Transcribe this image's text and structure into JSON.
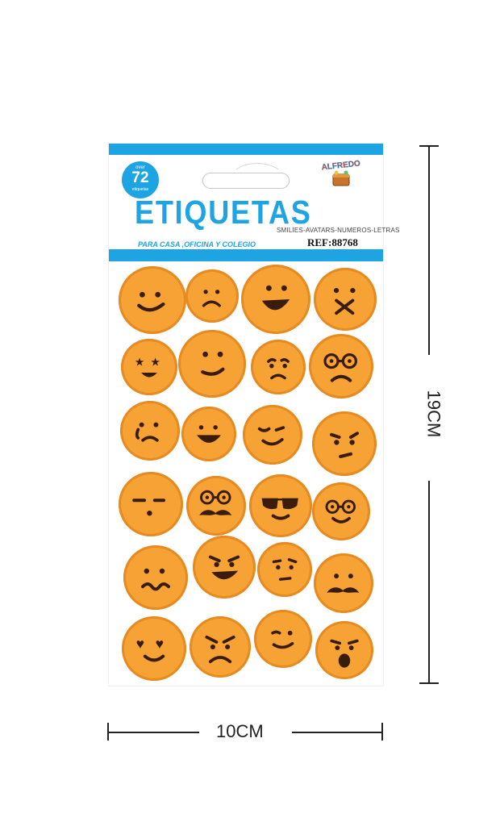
{
  "package": {
    "badge": {
      "over": "over",
      "count": "72",
      "unit": "etiquetas"
    },
    "brand": "ALFREDO",
    "title": "ETIQUETAS",
    "subtitle": "SMILIES-AVATARS-NUMEROS-LETRAS",
    "tagline": "PARA CASA ,OFICINA Y COLEGIO",
    "ref": "REF:88768"
  },
  "colors": {
    "accent": "#1ea4e3",
    "sticker": "#f6a234",
    "sticker_rim": "#e68a22",
    "ink": "#3a1c0c"
  },
  "stickers": [
    {
      "row": 1,
      "col": 1,
      "expression": "smile"
    },
    {
      "row": 1,
      "col": 2,
      "expression": "sad"
    },
    {
      "row": 1,
      "col": 3,
      "expression": "laugh"
    },
    {
      "row": 1,
      "col": 4,
      "expression": "taped-mouth"
    },
    {
      "row": 2,
      "col": 1,
      "expression": "star-eyes"
    },
    {
      "row": 2,
      "col": 2,
      "expression": "smirk"
    },
    {
      "row": 2,
      "col": 3,
      "expression": "worried"
    },
    {
      "row": 2,
      "col": 4,
      "expression": "glasses-frown"
    },
    {
      "row": 3,
      "col": 1,
      "expression": "crying"
    },
    {
      "row": 3,
      "col": 2,
      "expression": "grin"
    },
    {
      "row": 3,
      "col": 3,
      "expression": "wink"
    },
    {
      "row": 3,
      "col": 4,
      "expression": "suspicious"
    },
    {
      "row": 4,
      "col": 1,
      "expression": "surprised-squint"
    },
    {
      "row": 4,
      "col": 2,
      "expression": "glasses-mustache"
    },
    {
      "row": 4,
      "col": 3,
      "expression": "sunglasses"
    },
    {
      "row": 4,
      "col": 4,
      "expression": "glasses-smile"
    },
    {
      "row": 5,
      "col": 1,
      "expression": "confused"
    },
    {
      "row": 5,
      "col": 2,
      "expression": "evil-grin"
    },
    {
      "row": 5,
      "col": 3,
      "expression": "skeptical"
    },
    {
      "row": 5,
      "col": 4,
      "expression": "mustache"
    },
    {
      "row": 6,
      "col": 1,
      "expression": "heart-eyes"
    },
    {
      "row": 6,
      "col": 2,
      "expression": "angry"
    },
    {
      "row": 6,
      "col": 3,
      "expression": "content"
    },
    {
      "row": 6,
      "col": 4,
      "expression": "shocked"
    }
  ],
  "dimensions": {
    "width": "10CM",
    "height": "19CM"
  }
}
